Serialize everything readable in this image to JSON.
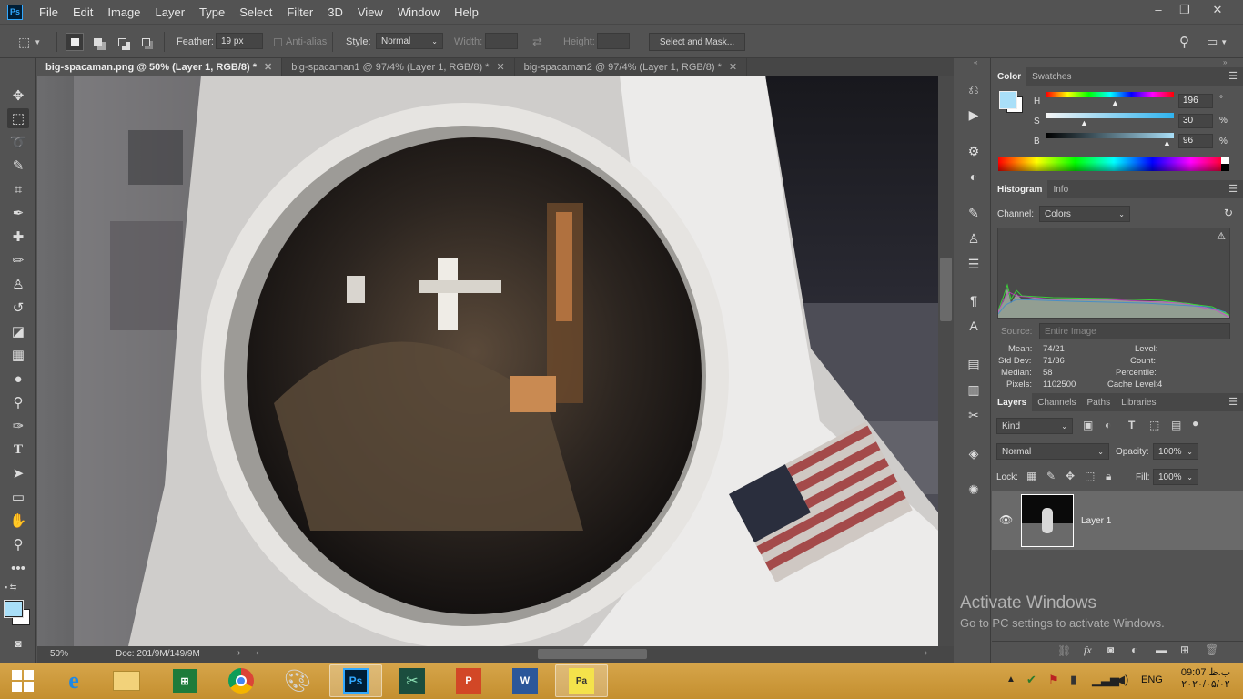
{
  "app": {
    "logo": "Ps"
  },
  "menu": [
    "File",
    "Edit",
    "Image",
    "Layer",
    "Type",
    "Select",
    "Filter",
    "3D",
    "View",
    "Window",
    "Help"
  ],
  "options": {
    "feather_label": "Feather:",
    "feather_value": "19 px",
    "antialias_label": "Anti-alias",
    "style_label": "Style:",
    "style_value": "Normal",
    "width_label": "Width:",
    "height_label": "Height:",
    "mask_button": "Select and Mask..."
  },
  "tabs": [
    {
      "label": "big-spacaman.png @ 50% (Layer 1, RGB/8) *",
      "active": true
    },
    {
      "label": "big-spacaman1 @ 97/4% (Layer 1, RGB/8) *",
      "active": false
    },
    {
      "label": "big-spacaman2 @ 97/4% (Layer 1, RGB/8) *",
      "active": false
    }
  ],
  "status": {
    "zoom": "50%",
    "doc": "Doc: 201/9M/149/9M"
  },
  "color_panel": {
    "tabs": [
      "Color",
      "Swatches"
    ],
    "h_label": "H",
    "h_value": "196",
    "h_unit": "°",
    "s_label": "S",
    "s_value": "30",
    "s_unit": "%",
    "b_label": "B",
    "b_value": "96",
    "b_unit": "%",
    "fg_color": "#a9dff8"
  },
  "histogram": {
    "tabs": [
      "Histogram",
      "Info"
    ],
    "channel_label": "Channel:",
    "channel_value": "Colors",
    "source_label": "Source:",
    "source_value": "Entire Image",
    "mean_label": "Mean:",
    "mean": "74/21",
    "stddev_label": "Std Dev:",
    "stddev": "71/36",
    "median_label": "Median:",
    "median": "58",
    "pixels_label": "Pixels:",
    "pixels": "1102500",
    "level_label": "Level:",
    "count_label": "Count:",
    "percentile_label": "Percentile:",
    "cache_label": "Cache Level:",
    "cache": "4"
  },
  "layers_panel": {
    "tabs": [
      "Layers",
      "Channels",
      "Paths",
      "Libraries"
    ],
    "kind": "Kind",
    "blend": "Normal",
    "opacity_label": "Opacity:",
    "opacity": "100%",
    "lock_label": "Lock:",
    "fill_label": "Fill:",
    "fill": "100%",
    "layer_name": "Layer 1"
  },
  "watermark": {
    "title": "Activate Windows",
    "subtitle": "Go to PC settings to activate Windows."
  },
  "taskbar": {
    "lang": "ENG",
    "time": "09:07 ب.ظ",
    "date": "۲۰۲۰/۰۵/۰۲"
  }
}
